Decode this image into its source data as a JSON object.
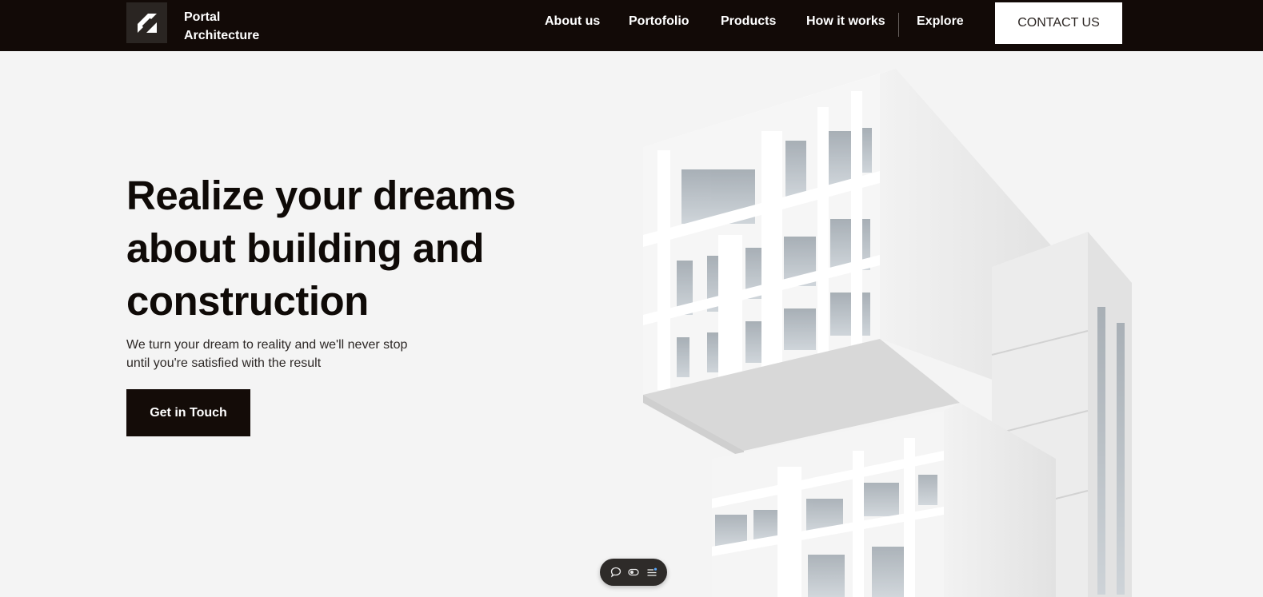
{
  "brand": {
    "line1": "Portal",
    "line2": "Architecture",
    "logo_icon": "portal-logo-icon"
  },
  "nav": {
    "items": [
      {
        "label": "About us"
      },
      {
        "label": "Portofolio"
      },
      {
        "label": "Products"
      },
      {
        "label": "How it works"
      },
      {
        "label": "Explore"
      }
    ],
    "contact_label": "CONTACT US"
  },
  "hero": {
    "title_lines": [
      "Realize your dreams",
      "about building and",
      "construction"
    ],
    "subtitle_lines": [
      "We turn your dream to reality and we'll never stop",
      "until you're satisfied with the result"
    ],
    "cta_label": "Get in Touch"
  },
  "toolbar": {
    "icons": [
      "comment-icon",
      "toggle-icon",
      "list-settings-icon"
    ]
  },
  "colors": {
    "nav_bg": "#120a07",
    "page_bg": "#f4f4f4",
    "cta_bg": "#140c08",
    "contact_bg": "#ffffff"
  }
}
